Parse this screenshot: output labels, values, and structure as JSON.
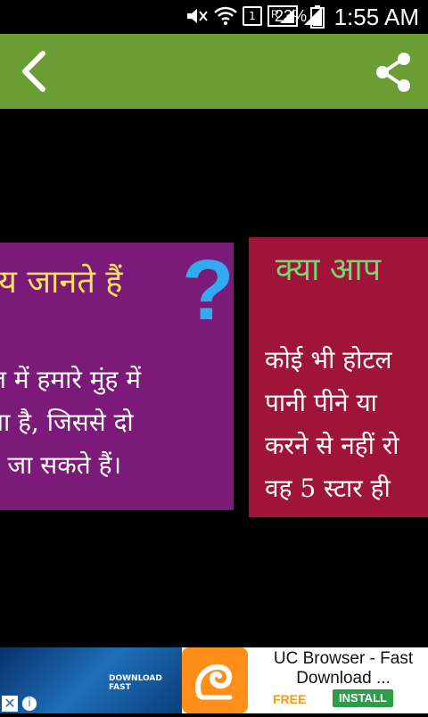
{
  "status_bar": {
    "battery": "23%",
    "time": "1:55 AM",
    "sim_label": "1",
    "roaming_label": "R",
    "icons": [
      "mute-icon",
      "wifi-icon",
      "sim-icon",
      "signal-roaming-icon",
      "signal-icon",
      "battery-icon"
    ]
  },
  "toolbar": {
    "color": "#6a9e35",
    "back_icon": "back-arrow-icon",
    "share_icon": "share-icon"
  },
  "cards": [
    {
      "title": "य जानते हैं",
      "qmark": "?",
      "lines": [
        "ल में हमारे मुंह में",
        "ता है, जिससे दो",
        "रे जा सकते हैं।"
      ],
      "bg": "#7b1a78"
    },
    {
      "title": "क्या आप",
      "lines": [
        "कोई भी होटल",
        "पानी पीने या",
        "करने से नहीं रो",
        "वह 5 स्टार ही"
      ],
      "bg": "#a0143a"
    }
  ],
  "ad": {
    "title": "UC Browser - Fast Download ...",
    "price": "FREE",
    "install_label": "INSTALL",
    "thumb_caption": "DOWNLOAD FAST"
  }
}
